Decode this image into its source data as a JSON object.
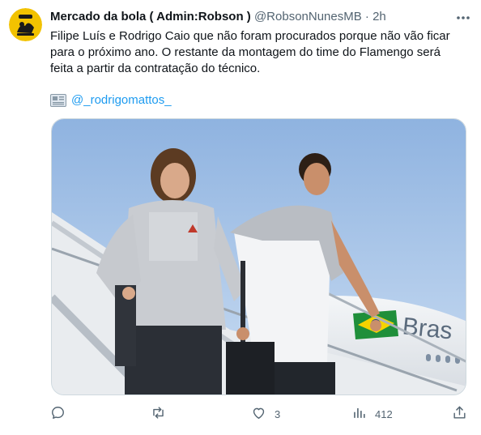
{
  "tweet": {
    "author_name": "Mercado da bola ( Admin:Robson )",
    "author_handle": "@RobsonNunesMB",
    "separator": "·",
    "time": "2h",
    "text": "Filipe Luís e Rodrigo Caio que não foram procurados porque não vão ficar para o próximo ano. O restante da montagem do time do Flamengo será feita a partir da contratação do técnico.",
    "source_link": "@_rodrigomattos_",
    "plane_text": "Bras",
    "icons": {
      "more": "more-horizontal-icon",
      "source": "newspaper-icon",
      "reply": "reply-icon",
      "retweet": "retweet-icon",
      "like": "heart-icon",
      "views": "views-chart-icon",
      "share": "share-icon"
    }
  },
  "actions": {
    "reply_count": "",
    "retweet_count": "",
    "like_count": "3",
    "views_count": "412"
  },
  "colors": {
    "link": "#1d9bf0",
    "secondary_text": "#536471",
    "avatar_bg": "#f2c200"
  }
}
